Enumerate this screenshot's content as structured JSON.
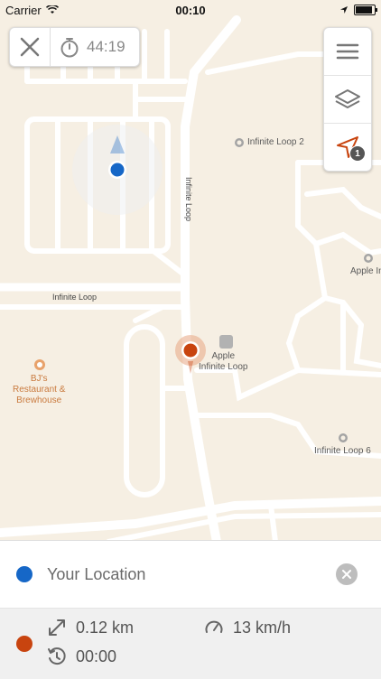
{
  "status_bar": {
    "carrier": "Carrier",
    "time": "00:10"
  },
  "timer": {
    "elapsed": "44:19"
  },
  "map": {
    "roads": [
      {
        "name": "Infinite Loop",
        "id": "road-infinite-loop-vertical"
      },
      {
        "name": "Infinite Loop",
        "id": "road-infinite-loop-horizontal"
      }
    ],
    "pois": [
      {
        "name": "Infinite Loop 2"
      },
      {
        "name": "Apple In"
      },
      {
        "name": "Apple\nInfinite Loop"
      },
      {
        "name": "BJ's\nRestaurant &\nBrewhouse"
      },
      {
        "name": "Infinite Loop 6"
      }
    ]
  },
  "controls": {
    "navigate_badge": "1"
  },
  "panel": {
    "location_label": "Your Location",
    "distance": "0.12 km",
    "speed": "13 km/h",
    "duration": "00:00"
  },
  "colors": {
    "user_dot": "#1667c7",
    "target_dot": "#c8440f",
    "map_bg": "#f6efe3",
    "road": "#ffffff"
  }
}
